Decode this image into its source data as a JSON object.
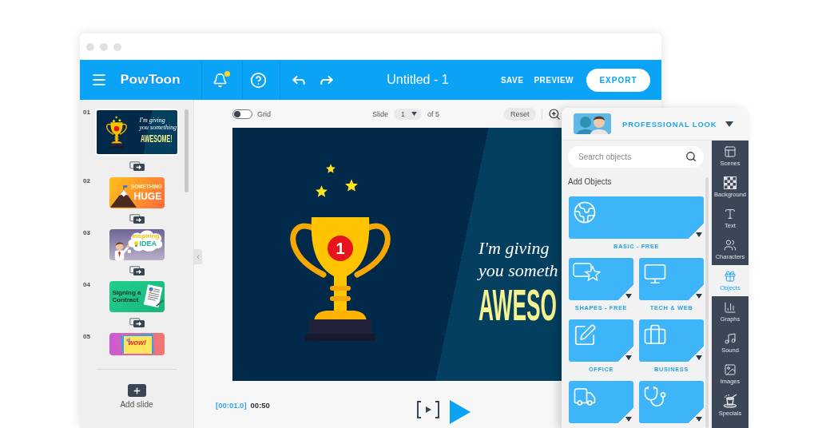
{
  "window": {
    "title": "Untitled - 1"
  },
  "toolbar": {
    "logo": "PowToon",
    "unread_notifications": true,
    "actions": [
      {
        "label": "SAVE",
        "kind": "link"
      },
      {
        "label": "PREVIEW",
        "kind": "link"
      },
      {
        "label": "EXPORT",
        "kind": "primary"
      }
    ]
  },
  "slides_panel": {
    "slides": [
      {
        "number": "01",
        "kind": "trophy",
        "selected": true,
        "lines": [
          "I'm giving",
          "you something",
          "AWESOME!"
        ]
      },
      {
        "number": "02",
        "kind": "mountain",
        "selected": false,
        "lines": [
          "SOMETHING",
          "HUGE"
        ]
      },
      {
        "number": "03",
        "kind": "idea",
        "selected": false,
        "lines": [
          "Inspiring",
          "IDEA"
        ]
      },
      {
        "number": "04",
        "kind": "contract",
        "selected": false,
        "lines": [
          "Signing a",
          "Contract"
        ]
      },
      {
        "number": "05",
        "kind": "wow",
        "selected": false,
        "lines": [
          "wow!"
        ]
      }
    ],
    "add_label": "Add slide"
  },
  "canvas_bar": {
    "grid": {
      "label": "Grid",
      "on": false
    },
    "slide_label": "Slide",
    "slide_value": "1",
    "slide_total": "of 5",
    "reset": "Reset"
  },
  "slide": {
    "lines": [
      {
        "text": "I'm giving",
        "kind": "script"
      },
      {
        "text": "you someth",
        "kind": "script"
      },
      {
        "text": "AWESO",
        "kind": "headline"
      }
    ],
    "medal": "1"
  },
  "playback": {
    "current": "[00:01.0]",
    "duration": "00:50"
  },
  "objects_panel": {
    "style": "PROFESSIONAL LOOK",
    "search": {
      "placeholder": "Search objects"
    },
    "heading": "Add Objects",
    "categories": [
      {
        "label": "BASIC - FREE",
        "kind": "globe",
        "wide": true
      },
      {
        "label": "SHAPES - FREE",
        "kind": "shapes",
        "wide": false
      },
      {
        "label": "TECH & WEB",
        "kind": "monitor",
        "wide": false
      },
      {
        "label": "OFFICE",
        "kind": "pen",
        "wide": false
      },
      {
        "label": "BUSINESS",
        "kind": "briefcase",
        "wide": false
      },
      {
        "kind": "truck",
        "wide": false
      },
      {
        "kind": "stethoscope",
        "wide": false
      }
    ],
    "tools": [
      {
        "label": "Scenes",
        "kind": "scenes",
        "selected": false
      },
      {
        "label": "Background",
        "kind": "background",
        "selected": false
      },
      {
        "label": "Text",
        "kind": "text",
        "selected": false
      },
      {
        "label": "Characters",
        "kind": "characters",
        "selected": false
      },
      {
        "label": "Objects",
        "kind": "objects",
        "selected": true
      },
      {
        "label": "Graphs",
        "kind": "graphs",
        "selected": false
      },
      {
        "label": "Sound",
        "kind": "sound",
        "selected": false
      },
      {
        "label": "Images",
        "kind": "images",
        "selected": false
      },
      {
        "label": "Specials",
        "kind": "specials",
        "selected": false
      }
    ]
  }
}
